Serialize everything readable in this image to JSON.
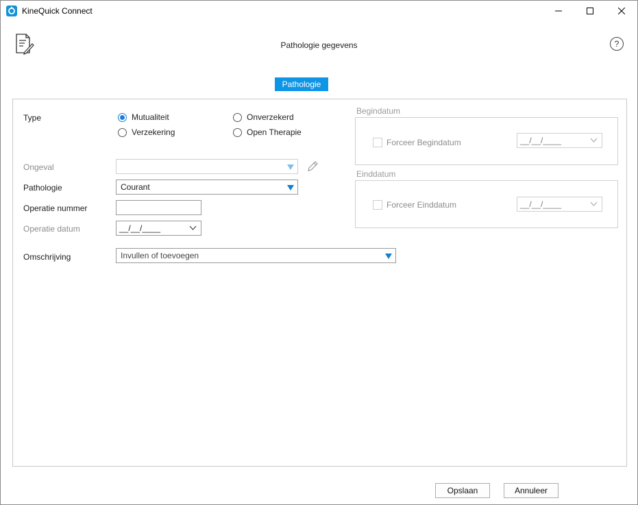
{
  "window": {
    "title": "KineQuick Connect"
  },
  "header": {
    "title": "Pathologie gegevens",
    "help": "?"
  },
  "tabs": [
    {
      "label": "Pathologie"
    }
  ],
  "form": {
    "type_label": "Type",
    "type_options": [
      {
        "label": "Mutualiteit",
        "checked": true
      },
      {
        "label": "Verzekering",
        "checked": false
      },
      {
        "label": "Onverzekerd",
        "checked": false
      },
      {
        "label": "Open Therapie",
        "checked": false
      }
    ],
    "ongeval_label": "Ongeval",
    "ongeval_value": "",
    "pathologie_label": "Pathologie",
    "pathologie_value": "Courant",
    "operatie_nummer_label": "Operatie nummer",
    "operatie_nummer_value": "",
    "operatie_datum_label": "Operatie datum",
    "operatie_datum_value": "__/__/____",
    "omschrijving_label": "Omschrijving",
    "omschrijving_placeholder": "Invullen of toevoegen"
  },
  "begindatum": {
    "title": "Begindatum",
    "checkbox_label": "Forceer Begindatum",
    "date_value": "__/__/____"
  },
  "einddatum": {
    "title": "Einddatum",
    "checkbox_label": "Forceer Einddatum",
    "date_value": "__/__/____"
  },
  "buttons": {
    "save": "Opslaan",
    "cancel": "Annuleer"
  },
  "colors": {
    "accent": "#0f95e6",
    "radio_checked": "#1a7fd6"
  }
}
